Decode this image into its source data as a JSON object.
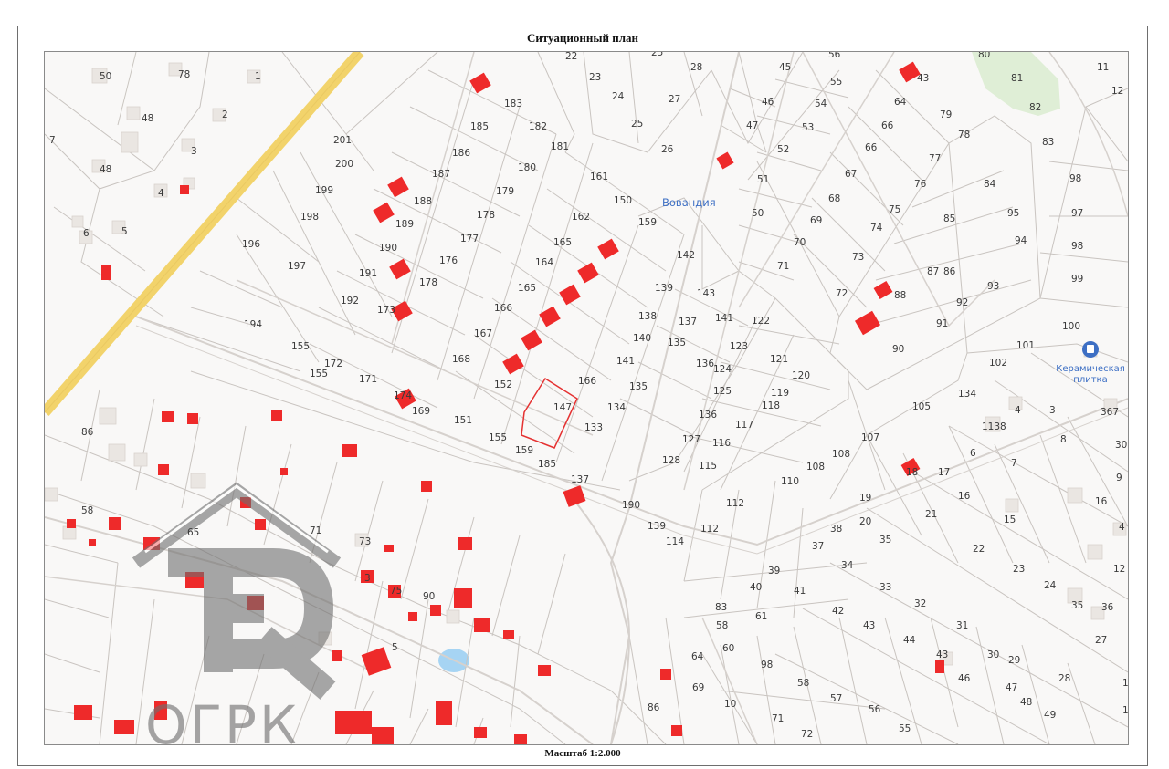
{
  "header": {
    "title": "Ситуационный план"
  },
  "footer": {
    "scale": "Масштаб 1:2.000"
  },
  "map": {
    "street_label": "Вовандия",
    "poi_label_line1": "Керамическая",
    "poi_label_line2": "плитка",
    "watermark": "ОГРК",
    "colors": {
      "building": "#ee2a2a",
      "road": "#f2d36b",
      "park": "#dfeed6",
      "water": "#a6d4f3",
      "plot_line": "#c9c4c0",
      "poi": "#3d6fc4"
    },
    "selected_plot": "147",
    "plots": [
      {
        "n": "50"
      },
      {
        "n": "78"
      },
      {
        "n": "1"
      },
      {
        "n": "48"
      },
      {
        "n": "2"
      },
      {
        "n": "7"
      },
      {
        "n": "3"
      },
      {
        "n": "48"
      },
      {
        "n": "4"
      },
      {
        "n": "5"
      },
      {
        "n": "6"
      },
      {
        "n": "22"
      },
      {
        "n": "25"
      },
      {
        "n": "28"
      },
      {
        "n": "23"
      },
      {
        "n": "183"
      },
      {
        "n": "24"
      },
      {
        "n": "27"
      },
      {
        "n": "185"
      },
      {
        "n": "182"
      },
      {
        "n": "25"
      },
      {
        "n": "26"
      },
      {
        "n": "186"
      },
      {
        "n": "181"
      },
      {
        "n": "180"
      },
      {
        "n": "187"
      },
      {
        "n": "179"
      },
      {
        "n": "188"
      },
      {
        "n": "178"
      },
      {
        "n": "189"
      },
      {
        "n": "177"
      },
      {
        "n": "190"
      },
      {
        "n": "176"
      },
      {
        "n": "191"
      },
      {
        "n": "178"
      },
      {
        "n": "192"
      },
      {
        "n": "173"
      },
      {
        "n": "201"
      },
      {
        "n": "200"
      },
      {
        "n": "199"
      },
      {
        "n": "198"
      },
      {
        "n": "196"
      },
      {
        "n": "197"
      },
      {
        "n": "155"
      },
      {
        "n": "194"
      },
      {
        "n": "161"
      },
      {
        "n": "150"
      },
      {
        "n": "162"
      },
      {
        "n": "159"
      },
      {
        "n": "165"
      },
      {
        "n": "164"
      },
      {
        "n": "165"
      },
      {
        "n": "166"
      },
      {
        "n": "167"
      },
      {
        "n": "168"
      },
      {
        "n": "152"
      },
      {
        "n": "147"
      },
      {
        "n": "166"
      },
      {
        "n": "135"
      },
      {
        "n": "134"
      },
      {
        "n": "133"
      },
      {
        "n": "141"
      },
      {
        "n": "140"
      },
      {
        "n": "142"
      },
      {
        "n": "139"
      },
      {
        "n": "143"
      },
      {
        "n": "138"
      },
      {
        "n": "141"
      },
      {
        "n": "137"
      },
      {
        "n": "135"
      },
      {
        "n": "136"
      },
      {
        "n": "155"
      },
      {
        "n": "172"
      },
      {
        "n": "171"
      },
      {
        "n": "174"
      },
      {
        "n": "169"
      },
      {
        "n": "151"
      },
      {
        "n": "155"
      },
      {
        "n": "159"
      },
      {
        "n": "185"
      },
      {
        "n": "137"
      },
      {
        "n": "190"
      },
      {
        "n": "139"
      },
      {
        "n": "122"
      },
      {
        "n": "123"
      },
      {
        "n": "121"
      },
      {
        "n": "124"
      },
      {
        "n": "120"
      },
      {
        "n": "125"
      },
      {
        "n": "119"
      },
      {
        "n": "118"
      },
      {
        "n": "136"
      },
      {
        "n": "117"
      },
      {
        "n": "127"
      },
      {
        "n": "116"
      },
      {
        "n": "128"
      },
      {
        "n": "115"
      },
      {
        "n": "45"
      },
      {
        "n": "56"
      },
      {
        "n": "55"
      },
      {
        "n": "46"
      },
      {
        "n": "54"
      },
      {
        "n": "47"
      },
      {
        "n": "53"
      },
      {
        "n": "52"
      },
      {
        "n": "51"
      },
      {
        "n": "50"
      },
      {
        "n": "43"
      },
      {
        "n": "64"
      },
      {
        "n": "79"
      },
      {
        "n": "66"
      },
      {
        "n": "78"
      },
      {
        "n": "66"
      },
      {
        "n": "77"
      },
      {
        "n": "67"
      },
      {
        "n": "76"
      },
      {
        "n": "68"
      },
      {
        "n": "75"
      },
      {
        "n": "69"
      },
      {
        "n": "74"
      },
      {
        "n": "70"
      },
      {
        "n": "73"
      },
      {
        "n": "71"
      },
      {
        "n": "72"
      },
      {
        "n": "80"
      },
      {
        "n": "81"
      },
      {
        "n": "82"
      },
      {
        "n": "11"
      },
      {
        "n": "12"
      },
      {
        "n": "83"
      },
      {
        "n": "98"
      },
      {
        "n": "84"
      },
      {
        "n": "95"
      },
      {
        "n": "97"
      },
      {
        "n": "85"
      },
      {
        "n": "94"
      },
      {
        "n": "98"
      },
      {
        "n": "86"
      },
      {
        "n": "87"
      },
      {
        "n": "93"
      },
      {
        "n": "99"
      },
      {
        "n": "88"
      },
      {
        "n": "92"
      },
      {
        "n": "91"
      },
      {
        "n": "90"
      },
      {
        "n": "100"
      },
      {
        "n": "101"
      },
      {
        "n": "102"
      },
      {
        "n": "134"
      },
      {
        "n": "105"
      },
      {
        "n": "1138"
      },
      {
        "n": "4"
      },
      {
        "n": "3"
      },
      {
        "n": "367"
      },
      {
        "n": "30"
      },
      {
        "n": "8"
      },
      {
        "n": "107"
      },
      {
        "n": "108"
      },
      {
        "n": "6"
      },
      {
        "n": "7"
      },
      {
        "n": "9"
      },
      {
        "n": "110"
      },
      {
        "n": "108"
      },
      {
        "n": "18"
      },
      {
        "n": "17"
      },
      {
        "n": "16"
      },
      {
        "n": "19"
      },
      {
        "n": "15"
      },
      {
        "n": "16"
      },
      {
        "n": "4"
      },
      {
        "n": "112"
      },
      {
        "n": "112"
      },
      {
        "n": "20"
      },
      {
        "n": "21"
      },
      {
        "n": "114"
      },
      {
        "n": "38"
      },
      {
        "n": "35"
      },
      {
        "n": "37"
      },
      {
        "n": "22"
      },
      {
        "n": "12"
      },
      {
        "n": "39"
      },
      {
        "n": "34"
      },
      {
        "n": "23"
      },
      {
        "n": "24"
      },
      {
        "n": "40"
      },
      {
        "n": "41"
      },
      {
        "n": "33"
      },
      {
        "n": "35"
      },
      {
        "n": "36"
      },
      {
        "n": "32"
      },
      {
        "n": "42"
      },
      {
        "n": "31"
      },
      {
        "n": "43"
      },
      {
        "n": "27"
      },
      {
        "n": "44"
      },
      {
        "n": "30"
      },
      {
        "n": "29"
      },
      {
        "n": "43"
      },
      {
        "n": "46"
      },
      {
        "n": "28"
      },
      {
        "n": "47"
      },
      {
        "n": "108"
      },
      {
        "n": "48"
      },
      {
        "n": "49"
      },
      {
        "n": "108"
      },
      {
        "n": "83"
      },
      {
        "n": "61"
      },
      {
        "n": "58"
      },
      {
        "n": "60"
      },
      {
        "n": "64"
      },
      {
        "n": "98"
      },
      {
        "n": "58"
      },
      {
        "n": "57"
      },
      {
        "n": "69"
      },
      {
        "n": "10"
      },
      {
        "n": "56"
      },
      {
        "n": "86"
      },
      {
        "n": "71"
      },
      {
        "n": "55"
      },
      {
        "n": "72"
      },
      {
        "n": "86"
      },
      {
        "n": "58"
      },
      {
        "n": "65"
      },
      {
        "n": "71"
      },
      {
        "n": "73"
      },
      {
        "n": "3"
      },
      {
        "n": "75"
      },
      {
        "n": "5"
      },
      {
        "n": "90"
      }
    ]
  }
}
